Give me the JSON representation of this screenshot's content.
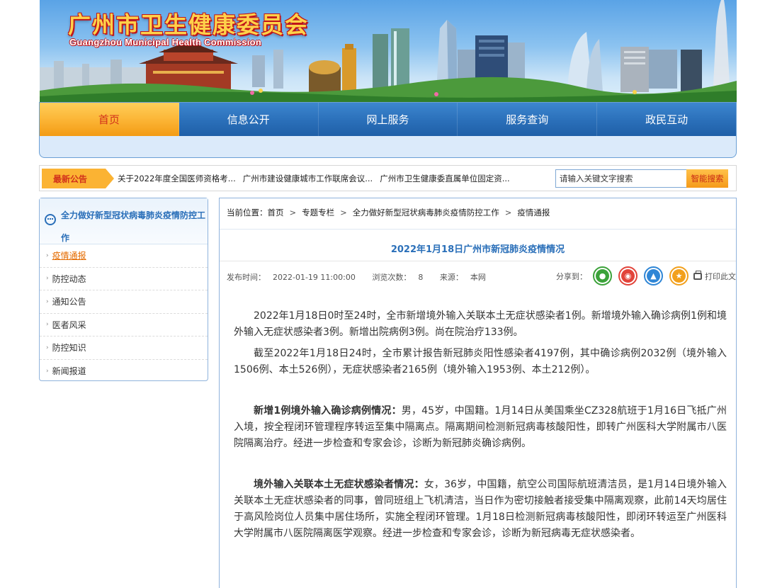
{
  "header": {
    "title": "广州市卫生健康委员会",
    "subtitle": "Guangzhou Municipal Health Commission"
  },
  "nav": {
    "items": [
      {
        "label": "首页",
        "active": true
      },
      {
        "label": "信息公开"
      },
      {
        "label": "网上服务"
      },
      {
        "label": "服务查询"
      },
      {
        "label": "政民互动"
      }
    ]
  },
  "notice": {
    "label": "最新公告",
    "items": [
      "关于2022年度全国医师资格考...",
      "广州市建设健康城市工作联席会议...",
      "广州市卫生健康委直属单位固定资..."
    ],
    "search_placeholder": "请输入关键文字搜索",
    "search_button": "智能搜索"
  },
  "sidebar": {
    "title": "全力做好新型冠状病毒肺炎疫情防控工作",
    "items": [
      {
        "label": "疫情通报",
        "active": true
      },
      {
        "label": "防控动态"
      },
      {
        "label": "通知公告"
      },
      {
        "label": "医者风采"
      },
      {
        "label": "防控知识"
      },
      {
        "label": "新闻报道"
      }
    ]
  },
  "breadcrumb": {
    "prefix": "当前位置：",
    "items": [
      "首页",
      "专题专栏",
      "全力做好新型冠状病毒肺炎疫情防控工作",
      "疫情通报"
    ],
    "separator": ">"
  },
  "article": {
    "title": "2022年1月18日广州市新冠肺炎疫情情况",
    "meta": {
      "publish_label": "发布时间：",
      "publish_time": "2022-01-19 11:00:00",
      "views_label": "浏览次数：",
      "views": "8",
      "source_label": "来源：",
      "source": "本网"
    },
    "share_label": "分享到：",
    "print_label": "打印此文",
    "p1": "2022年1月18日0时至24时，全市新增境外输入关联本土无症状感染者1例。新增境外输入确诊病例1例和境外输入无症状感染者3例。新增出院病例3例。尚在院治疗133例。",
    "p2": "截至2022年1月18日24时，全市累计报告新冠肺炎阳性感染者4197例，其中确诊病例2032例（境外输入1506例、本土526例），无症状感染者2165例（境外输入1953例、本土212例）。",
    "p3_bold": "新增1例境外输入确诊病例情况：",
    "p3": "男，45岁，中国籍。1月14日从美国乘坐CZ328航班于1月16日飞抵广州入境，按全程闭环管理程序转运至集中隔离点。隔离期间检测新冠病毒核酸阳性，即转广州医科大学附属市八医院隔离治疗。经进一步检查和专家会诊，诊断为新冠肺炎确诊病例。",
    "p4_bold": "境外输入关联本土无症状感染者情况：",
    "p4": "女，36岁，中国籍，航空公司国际航班清洁员，是1月14日境外输入关联本土无症状感染者的同事，曾同班组上飞机清洁，当日作为密切接触者接受集中隔离观察，此前14天均居住于高风险岗位人员集中居住场所，实施全程闭环管理。1月18日检测新冠病毒核酸阳性，即闭环转运至广州医科大学附属市八医院隔离医学观察。经进一步检查和专家会诊，诊断为新冠病毒无症状感染者。"
  }
}
